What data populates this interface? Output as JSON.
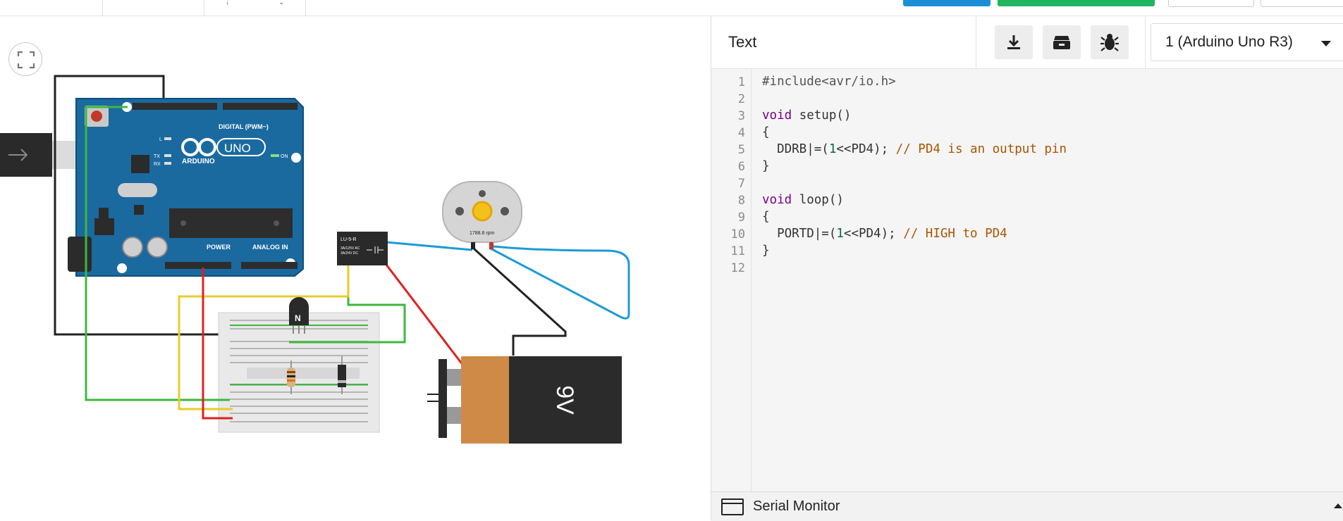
{
  "editor": {
    "mode_label": "Text",
    "device_select": "1 (Arduino Uno R3)",
    "toolbar_icons": [
      "download-icon",
      "library-icon",
      "debugger-icon"
    ],
    "line_numbers": [
      "1",
      "2",
      "3",
      "4",
      "5",
      "6",
      "7",
      "8",
      "9",
      "10",
      "11",
      "12"
    ],
    "code": {
      "l1": "#include<avr/io.h>",
      "l3_kw": "void",
      "l3_rest": " setup()",
      "l4": "{",
      "l5_a": "  DDRB|=(",
      "l5_num": "1",
      "l5_b": "<<PD4); ",
      "l5_cm": "// PD4 is an output pin",
      "l6": "}",
      "l8_kw": "void",
      "l8_rest": " loop()",
      "l9": "{",
      "l10_a": "  PORTD|=(",
      "l10_num": "1",
      "l10_b": "<<PD4); ",
      "l10_cm": "// HIGH to PD4",
      "l11": "}"
    }
  },
  "serial_monitor": {
    "label": "Serial Monitor"
  },
  "circuit": {
    "arduino": {
      "label_digital": "DIGITAL (PWM~)",
      "label_brand": "ARDUINO",
      "label_model": "UNO",
      "label_on": "ON",
      "label_power": "POWER",
      "label_analog": "ANALOG IN",
      "led_l": "L",
      "led_tx": "TX",
      "led_rx": "RX"
    },
    "relay": {
      "label": "LU-5-R",
      "spec1": "3A/125V AC",
      "spec2": "3A/24V DC"
    },
    "motor": {
      "speed": "1788.8 rpm"
    },
    "battery": {
      "label": "9V"
    },
    "transistor": {
      "label": "N"
    }
  },
  "colors": {
    "arduino_blue": "#1a6aa0",
    "wire_green": "#3db83d",
    "wire_yellow": "#e8cc2a",
    "wire_red": "#e02020",
    "wire_blue": "#1e9ad6",
    "wire_black": "#222222",
    "battery_orange": "#cf8a47",
    "battery_black": "#2b2b2b"
  }
}
